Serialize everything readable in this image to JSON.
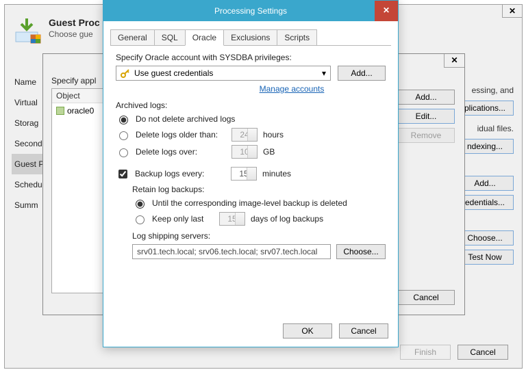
{
  "win1": {
    "title": "Guest Proc",
    "subtitle": "Choose gue",
    "nav": [
      "Name",
      "Virtual",
      "Storag",
      "Second",
      "Guest P",
      "Schedu",
      "Summ"
    ],
    "rightcol": {
      "frag1": "essing, and",
      "btn_apps": "plications...",
      "frag2": "idual files.",
      "btn_indexing": "ndexing...",
      "btn_add": "Add...",
      "btn_cred": "edentials...",
      "btn_choose": "Choose...",
      "btn_testnow": "Test Now"
    },
    "footer": {
      "finish": "Finish",
      "cancel": "Cancel"
    }
  },
  "win2": {
    "label": "Specify appl",
    "obj_header": "Object",
    "obj_item": "oracle0",
    "btns": {
      "add": "Add...",
      "edit": "Edit...",
      "remove": "Remove"
    },
    "cancel": "Cancel"
  },
  "win3": {
    "title": "Processing Settings",
    "tabs": [
      "General",
      "SQL",
      "Oracle",
      "Exclusions",
      "Scripts"
    ],
    "active_tab": 2,
    "specify_label": "Specify Oracle account with SYSDBA privileges:",
    "credentials_select": "Use guest credentials",
    "btn_add": "Add...",
    "manage_link": "Manage accounts",
    "archived_label": "Archived logs:",
    "radio_nodelete": "Do not delete archived logs",
    "radio_older": "Delete logs older than:",
    "older_value": "24",
    "older_unit": "hours",
    "radio_over": "Delete logs over:",
    "over_value": "10",
    "over_unit": "GB",
    "check_backup": "Backup logs every:",
    "backup_value": "15",
    "backup_unit": "minutes",
    "retain_label": "Retain log backups:",
    "retain_until": "Until the corresponding image-level backup is deleted",
    "retain_keep": "Keep only last",
    "keep_value": "15",
    "keep_unit": "days of log backups",
    "ship_label": "Log shipping servers:",
    "ship_value": "srv01.tech.local; srv06.tech.local; srv07.tech.local",
    "btn_choose": "Choose...",
    "ok": "OK",
    "cancel": "Cancel"
  }
}
